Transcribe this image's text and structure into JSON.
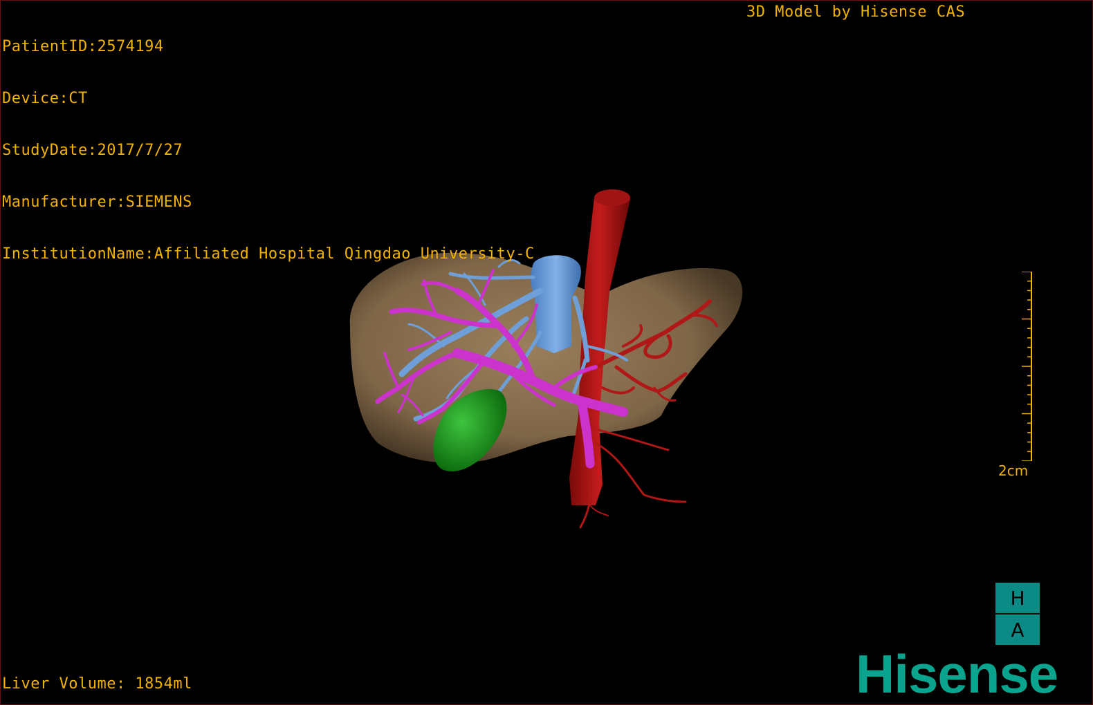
{
  "patient_info": {
    "patient_id": "PatientID:2574194",
    "device": "Device:CT",
    "study_date": "StudyDate:2017/7/27",
    "manufacturer": "Manufacturer:SIEMENS",
    "institution": "InstitutionName:Affiliated Hospital Qingdao University-C"
  },
  "title": "3D Model by Hisense CAS",
  "liver_volume": "Liver Volume: 1854ml",
  "scale": {
    "label": "2cm"
  },
  "orientation": {
    "top": "H",
    "bottom": "A"
  },
  "logo_text": "Hisense",
  "colors": {
    "overlay_text": "#f2b200",
    "liver": "#8a6f4e",
    "portal_vein": "#cc33cc",
    "hepatic_vein": "#6f9fd8",
    "artery": "#b01818",
    "gallbladder": "#1a9a1a",
    "brand": "#0aa38e"
  }
}
